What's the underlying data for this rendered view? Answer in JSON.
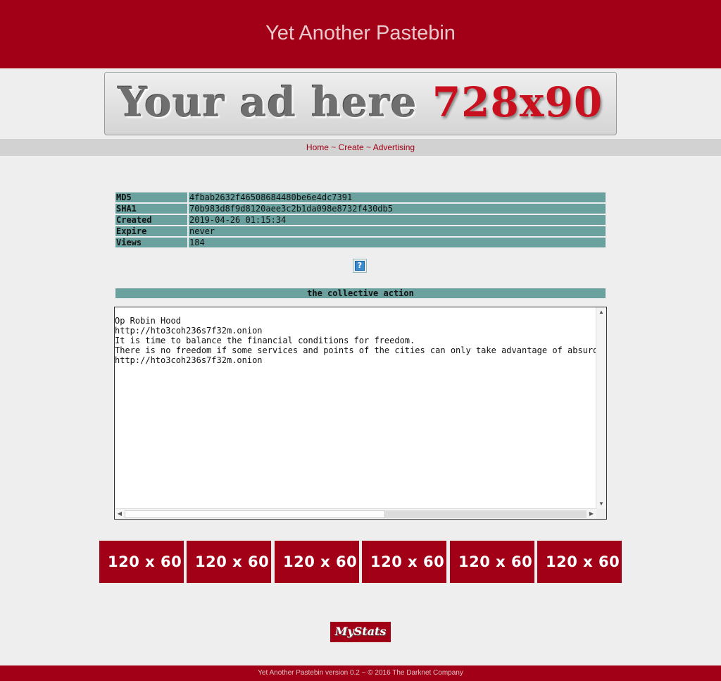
{
  "header": {
    "title": "Yet Another Pastebin"
  },
  "banner_ad": {
    "part1": "Your ad here",
    "part2": "728x90"
  },
  "nav": {
    "home": "Home",
    "create": "Create",
    "advertising": "Advertising",
    "sep": "~"
  },
  "meta": [
    {
      "key": "MD5",
      "value": "4fbab2632f46508684480be6e4dc7391"
    },
    {
      "key": "SHA1",
      "value": "70b983d8f9d8120aee3c2b1da098e8732f430db5"
    },
    {
      "key": "Created",
      "value": "2019-04-26 01:15:34"
    },
    {
      "key": "Expire",
      "value": "never"
    },
    {
      "key": "Views",
      "value": "184"
    }
  ],
  "help": {
    "label": "?"
  },
  "paste": {
    "title": "the collective action",
    "content": "Op Robin Hood\nhttp://hto3coh236s7f32m.onion\nIt is time to balance the financial conditions for freedom.\nThere is no freedom if some services and points of the cities can only take advantage of absurd\nhttp://hto3coh236s7f32m.onion"
  },
  "small_ads": [
    "120 x 60",
    "120 x 60",
    "120 x 60",
    "120 x 60",
    "120 x 60",
    "120 x 60"
  ],
  "mystats": {
    "label": "MyStats"
  },
  "footer": {
    "text": "Yet Another Pastebin version 0.2 ~ © 2016 The Darknet Company"
  },
  "colors": {
    "brand": "#a10016",
    "table": "#6aa09d",
    "background": "#eeeeee"
  }
}
